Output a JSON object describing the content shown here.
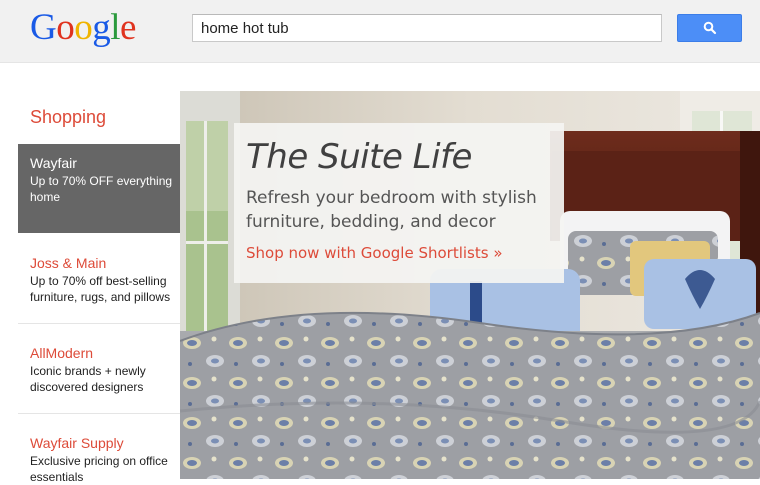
{
  "logo": {
    "letters": [
      "G",
      "o",
      "o",
      "g",
      "l",
      "e"
    ],
    "colors": [
      "#1a5ae6",
      "#e0331f",
      "#f0b400",
      "#1a5ae6",
      "#2b9a3d",
      "#e0331f"
    ]
  },
  "search": {
    "query": "home hot tub",
    "button_icon": "search-icon"
  },
  "sidebar": {
    "title": "Shopping",
    "items": [
      {
        "name": "Wayfair",
        "desc": "Up to 70% OFF everything home",
        "active": true
      },
      {
        "name": "Joss & Main",
        "desc": "Up to 70% off best-selling furniture, rugs, and pillows",
        "active": false
      },
      {
        "name": "AllModern",
        "desc": "Iconic brands + newly discovered designers",
        "active": false
      },
      {
        "name": "Wayfair Supply",
        "desc": "Exclusive pricing on office essentials",
        "active": false
      }
    ]
  },
  "hero": {
    "title": "The Suite Life",
    "subtitle": "Refresh your bedroom with stylish furniture, bedding, and decor",
    "link": "Shop now with Google Shortlists »"
  },
  "colors": {
    "accent": "#dd4b39",
    "search_button": "#4c8ef7",
    "active_item": "#666666"
  }
}
